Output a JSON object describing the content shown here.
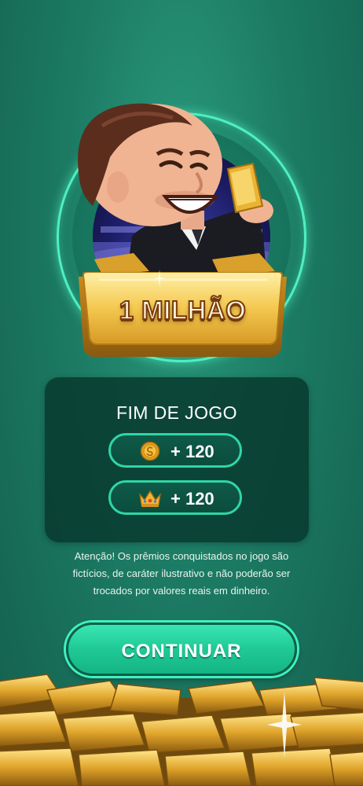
{
  "prize": {
    "label": "1 MILHÃO"
  },
  "result": {
    "title": "FIM DE JOGO",
    "rewards": [
      {
        "icon": "coin-icon",
        "amount": "+ 120"
      },
      {
        "icon": "crown-icon",
        "amount": "+ 120"
      }
    ]
  },
  "disclaimer": {
    "line1": "Atenção! Os prêmios conquistados no jogo são",
    "line2": "fictícios, de caráter ilustrativo e não poderão ser",
    "line3": "trocados por valores reais em dinheiro."
  },
  "actions": {
    "continue_label": "CONTINUAR"
  },
  "colors": {
    "background": "#1c7a63",
    "accent": "#3ff2be",
    "gold": "#e8b53a",
    "panel": "#07372c"
  }
}
